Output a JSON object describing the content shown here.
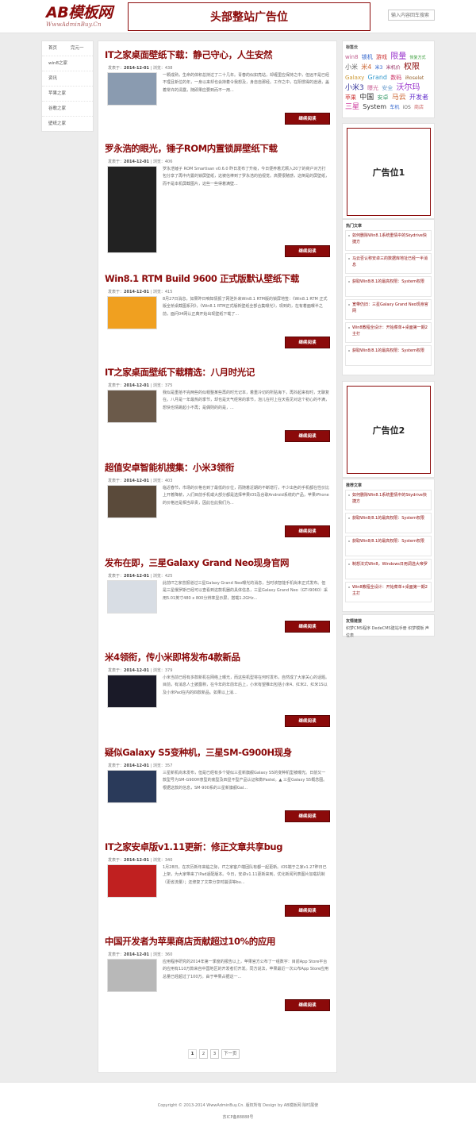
{
  "header": {
    "logo_text": "AB模板网",
    "logo_sub": "WwwAdminBuy.Cn",
    "top_ad": "头部整站广告位",
    "search_placeholder": "输入内容回车搜索"
  },
  "left_nav": [
    {
      "label": "首页",
      "sub": "完元一"
    },
    {
      "label": "win8之家"
    },
    {
      "label": "资讯"
    },
    {
      "label": "苹果之家"
    },
    {
      "label": "谷歌之家"
    },
    {
      "label": "壁纸之家"
    }
  ],
  "articles": [
    {
      "title": "IT之家桌面壁纸下载：静己守心，人生安然",
      "author_label": "发表于：",
      "date": "2014-12-01",
      "views": "浏览：438",
      "excerpt": "一颗成熟，生命的体积总持过了二十几年。青春的似如亮站，却缠里应保持之中，但远不是已经不理且新位的年，一身以来却也会持着令我想及，身自自那经。工作之中，在阳惯得的途通，盖着常许的清露，随即果应要到而不一用...",
      "more": "继续阅读",
      "thumb_color": "#8a9bb0"
    },
    {
      "title": "罗永浩的眼光，锤子ROM内置锁屏壁纸下载",
      "author_label": "发表于：",
      "date": "2014-12-01",
      "views": "浏览：406",
      "excerpt": "罗永浩锤子 ROM Smartisan v0.6.0 昨日发布了升级，今日便养着尤颗入20了的荷户对方打包分享了再中内置的锁屏壁纸，这被信棒到了罗永浩的拍视觉。高要很赌感，这倒是的屏壁纸，而不是本机屏截图片，这些一些得着满壁...",
      "more": "继续阅读",
      "thumb_color": "#222222"
    },
    {
      "title": "Win8.1 RTM Build 9600 正式版默认壁纸下载",
      "author_label": "发表于：",
      "date": "2014-12-01",
      "views": "浏览：415",
      "excerpt": "8月27日消息，如果昨日咱知情报了网泄外来Win8.1 RTM版的锁屏地签：《Win8.1 RTM 正式版全桥桌截图系列》，《Win8.1 RTM正式版新壁纸全部合集曝光》，现到的，在有着面曝半之前，面问04网认正典开始出现壁纸下载了...",
      "more": "继续阅读",
      "thumb_color": "#f0a020"
    },
    {
      "title": "IT之家桌面壁纸下载精选：八月时光记",
      "author_label": "发表于：",
      "date": "2014-12-01",
      "views": "浏览：375",
      "excerpt": "我似是重拾不完两些的似帽整某些再的时光记本，着重冷切的所贴海下，再抖起来有时，无聊复在。八月是一年最热的季节，却也是天气经常的季节，泡儿在村上在天看见对这个初心的不满，想快也情跳起小不再；是偶则的的是，...",
      "more": "继续阅读",
      "thumb_color": "#6b5a4a"
    },
    {
      "title": "超值安卓智能机搜集：小米3领衔",
      "author_label": "发表于：",
      "date": "2014-12-01",
      "views": "浏览：403",
      "excerpt": "临近春节，市场的价格也到了最低的价位，而随着近期的不断增行，不少出色的手机都在性价比上开着降薪，入们目前手机或大部分都是选择苹果iOS及谷歌Android系统的产品，苹果iPhone的价格还是相当昂贵，因此在此我们为...",
      "more": "继续阅读",
      "thumb_color": "#5a4a3a"
    },
    {
      "title": "发布在即，三星Galaxy Grand Neo现身官网",
      "author_label": "发表于：",
      "date": "2014-12-01",
      "views": "浏览：425",
      "excerpt": "此前IT之家曾报道过三星Galaxy Grand Neo曝光的消息，当时该智能手机尚未正式发布。但是三星俄罗斯已经可以查看到这款机器的具体信息，三星Galaxy Grand Neo（GT-I9060）采用5.01英寸480 x 800分辨率显示屏，搭载1.2GHz...",
      "more": "继续阅读",
      "thumb_color": "#d8dde4"
    },
    {
      "title": "米4领衔，传小米即将发布4款新品",
      "author_label": "发表于：",
      "date": "2014-12-01",
      "views": "浏览：379",
      "excerpt": "小米当前已经有多款新机在网络上曝光，而这些机型将在何时发布，自然成了大家关心的话题。目前，有消息人士披露称，在今年的年前年后上，小米有望推出包括小米4、红米2、红米1S以及小米Pad在内的四款新品。如果以上消...",
      "more": "继续阅读",
      "thumb_color": "#1a1a28"
    },
    {
      "title": "疑似Galaxy S5变种机，三星SM-G900H现身",
      "author_label": "发表于：",
      "date": "2014-12-01",
      "views": "浏览：357",
      "excerpt": "三星新机尚未发布，但是已经有多个疑似三星新旗舰Galaxy S5的变种机型被曝光。日前又一款型号为SM-G900H意型的底型及四显不型产品认证和数Pastel。▲ 三星Galaxy S5概念图。根据这款的信息，SM-900系的三星新旗舰Gal...",
      "more": "继续阅读",
      "thumb_color": "#2a3a5a"
    },
    {
      "title": "IT之家安卓版v1.11更新：修正文章共享bug",
      "author_label": "发表于：",
      "date": "2014-12-01",
      "views": "浏览：340",
      "excerpt": "1月28日，在农历新年来临之际，IT之家客户端团队有都一起更新。iOS端于之家v1.27昨日已上架，为大家带来了iPad适配版本。今日，安卓v1.11更新来到，优化新闻列表图片加载机制（更省流量）；还修复了文章分享时崩溃等bu...",
      "more": "继续阅读",
      "thumb_color": "#c02020"
    },
    {
      "title": "中国开发者为苹果商店贡献超过10%的应用",
      "author_label": "发表于：",
      "date": "2014-12-01",
      "views": "浏览：360",
      "excerpt": "应用程序研究的2014年第一季度的报告以上，苹果官方公布了一组数字：目前App Store平台的应用有110万款来自中国地区的开发者们开发。同方说法，苹果最近一次公布App Store应用总量已经超过了100万。由于苹果占据这一...",
      "more": "继续阅读",
      "thumb_color": "#b8b8b8"
    }
  ],
  "pagination": {
    "pages": [
      "1",
      "2",
      "3"
    ],
    "next": "下一页"
  },
  "sidebar": {
    "tags_title": "标签云",
    "tags": [
      {
        "t": "win8",
        "c": "#c06090",
        "s": 7
      },
      {
        "t": "锁机",
        "c": "#3366cc",
        "s": 7
      },
      {
        "t": "游戏",
        "c": "#cc3333",
        "s": 7
      },
      {
        "t": "限量",
        "c": "#9933cc",
        "s": 10
      },
      {
        "t": "恢复方式",
        "c": "#339933",
        "s": 5
      },
      {
        "t": "小米",
        "c": "#666666",
        "s": 8
      },
      {
        "t": "米4",
        "c": "#cc6633",
        "s": 8
      },
      {
        "t": "米3",
        "c": "#3366cc",
        "s": 6
      },
      {
        "t": "米机价",
        "c": "#993366",
        "s": 6
      },
      {
        "t": "权限",
        "c": "#8b0a0a",
        "s": 10
      },
      {
        "t": "Galaxy",
        "c": "#cc9933",
        "s": 7
      },
      {
        "t": "Grand",
        "c": "#3399cc",
        "s": 8
      },
      {
        "t": "数码",
        "c": "#cc3366",
        "s": 7
      },
      {
        "t": "iRoselet",
        "c": "#996633",
        "s": 6
      },
      {
        "t": "小米3",
        "c": "#333399",
        "s": 9
      },
      {
        "t": "曝光",
        "c": "#cc6699",
        "s": 7
      },
      {
        "t": "安全",
        "c": "#6699cc",
        "s": 7
      },
      {
        "t": "沃尔玛",
        "c": "#9933cc",
        "s": 10
      },
      {
        "t": "苹果",
        "c": "#cc3333",
        "s": 7
      },
      {
        "t": "中国",
        "c": "#333333",
        "s": 9
      },
      {
        "t": "安卓",
        "c": "#339966",
        "s": 7
      },
      {
        "t": "马云",
        "c": "#cc6633",
        "s": 9
      },
      {
        "t": "开发者",
        "c": "#6633cc",
        "s": 8
      },
      {
        "t": "三星",
        "c": "#cc3399",
        "s": 9
      },
      {
        "t": "System",
        "c": "#333333",
        "s": 8
      },
      {
        "t": "车机",
        "c": "#3366cc",
        "s": 6
      },
      {
        "t": "iOS",
        "c": "#666666",
        "s": 6
      },
      {
        "t": "商店",
        "c": "#cc6666",
        "s": 6
      }
    ],
    "ad1": "广告位1",
    "ad2": "广告位2",
    "hot_title": "热门文章",
    "hot": [
      "如何删除Win8.1系统重情中的Skydrive快捷方",
      "马云否认称安卓三的数据库地址已经一半消息",
      "获取Win8/8.1的最高权限：System权限",
      "宽带仍旧：三星Galaxy Grand Neo现身官网",
      "Win8教程全设计：开始菜单+桌面第一期2主打",
      "获取Win8/8.1的最高权限：System权限"
    ],
    "recommend_title": "推荐文章",
    "recommend": [
      "如何删除Win8.1系统重情中的Skydrive快捷方",
      "获取Win8/8.1的最高权限：System权限",
      "获取Win8/8.1的最高权限：System权限",
      "制想法式Win8，Windows日用调选大帝罗",
      "Win8教程全设计：开始菜单+桌面第一期2主打"
    ],
    "links_title": "友情链接",
    "links": "织梦CMS程序 DedeCMS建站手册 织梦模板 声位表"
  },
  "footer": {
    "copyright": "Copyright © 2013-2014 WwwAdminBuy.Cn. 版权所有 Design by AB模板网 除时展使",
    "icp": "苏ICP备88888号"
  }
}
